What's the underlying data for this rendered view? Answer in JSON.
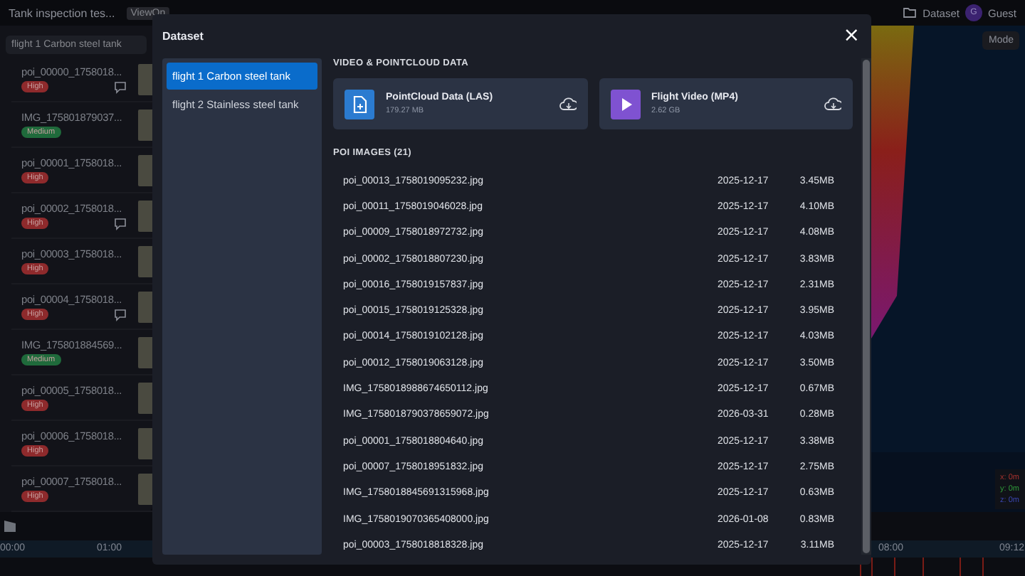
{
  "app": {
    "title": "Tank inspection tes...",
    "badge": "ViewOn",
    "dataset_button": "Dataset",
    "avatar": "G",
    "user": "Guest",
    "mode_button": "Mode"
  },
  "search": {
    "value": "flight 1 Carbon steel tank"
  },
  "poi_list": [
    {
      "name": "poi_00000_1758018...",
      "severity": "High",
      "color": "#8e2a2c",
      "comment": true
    },
    {
      "name": "IMG_175801879037...",
      "severity": "Medium",
      "color": "#1f6a3b",
      "comment": false
    },
    {
      "name": "poi_00001_1758018...",
      "severity": "High",
      "color": "#8e2a2c",
      "comment": false
    },
    {
      "name": "poi_00002_1758018...",
      "severity": "High",
      "color": "#8e2a2c",
      "comment": true
    },
    {
      "name": "poi_00003_1758018...",
      "severity": "High",
      "color": "#8e2a2c",
      "comment": false
    },
    {
      "name": "poi_00004_1758018...",
      "severity": "High",
      "color": "#8e2a2c",
      "comment": true
    },
    {
      "name": "IMG_175801884569...",
      "severity": "Medium",
      "color": "#1f6a3b",
      "comment": false
    },
    {
      "name": "poi_00005_1758018...",
      "severity": "High",
      "color": "#8e2a2c",
      "comment": false
    },
    {
      "name": "poi_00006_1758018...",
      "severity": "High",
      "color": "#8e2a2c",
      "comment": false
    },
    {
      "name": "poi_00007_1758018...",
      "severity": "High",
      "color": "#8e2a2c",
      "comment": false
    }
  ],
  "coordinates": [
    {
      "text": "x: 0m",
      "color": "#a8322e"
    },
    {
      "text": "y: 0m",
      "color": "#2f9a3a"
    },
    {
      "text": "z: 0m",
      "color": "#3b46b0"
    }
  ],
  "timeline": {
    "ticks": [
      "00:00",
      "01:00",
      "08:00",
      "09:12"
    ]
  },
  "dialog": {
    "title": "Dataset",
    "close": "×",
    "flights": [
      {
        "label": "flight 1 Carbon steel tank",
        "selected": true
      },
      {
        "label": "flight 2 Stainless steel tank",
        "selected": false
      }
    ],
    "media_heading": "VIDEO & POINTCLOUD DATA",
    "media": [
      {
        "kind": "pointcloud",
        "title": "PointCloud Data (LAS)",
        "size": "179.27 MB"
      },
      {
        "kind": "video",
        "title": "Flight Video (MP4)",
        "size": "2.62 GB"
      }
    ],
    "images_heading": "POI IMAGES (21)",
    "images": [
      {
        "name": "poi_00013_1758019095232.jpg",
        "date": "2025-12-17",
        "size": "3.45MB"
      },
      {
        "name": "poi_00011_1758019046028.jpg",
        "date": "2025-12-17",
        "size": "4.10MB"
      },
      {
        "name": "poi_00009_1758018972732.jpg",
        "date": "2025-12-17",
        "size": "4.08MB"
      },
      {
        "name": "poi_00002_1758018807230.jpg",
        "date": "2025-12-17",
        "size": "3.83MB"
      },
      {
        "name": "poi_00016_1758019157837.jpg",
        "date": "2025-12-17",
        "size": "2.31MB"
      },
      {
        "name": "poi_00015_1758019125328.jpg",
        "date": "2025-12-17",
        "size": "3.95MB"
      },
      {
        "name": "poi_00014_1758019102128.jpg",
        "date": "2025-12-17",
        "size": "4.03MB"
      },
      {
        "name": "poi_00012_1758019063128.jpg",
        "date": "2025-12-17",
        "size": "3.50MB"
      },
      {
        "name": "IMG_1758018988674650112.jpg",
        "date": "2025-12-17",
        "size": "0.67MB"
      },
      {
        "name": "IMG_1758018790378659072.jpg",
        "date": "2026-03-31",
        "size": "0.28MB"
      },
      {
        "name": "poi_00001_1758018804640.jpg",
        "date": "2025-12-17",
        "size": "3.38MB"
      },
      {
        "name": "poi_00007_1758018951832.jpg",
        "date": "2025-12-17",
        "size": "2.75MB"
      },
      {
        "name": "IMG_1758018845691315968.jpg",
        "date": "2025-12-17",
        "size": "0.63MB"
      },
      {
        "name": "IMG_1758019070365408000.jpg",
        "date": "2026-01-08",
        "size": "0.83MB"
      },
      {
        "name": "poi_00003_1758018818328.jpg",
        "date": "2025-12-17",
        "size": "3.11MB"
      }
    ]
  }
}
